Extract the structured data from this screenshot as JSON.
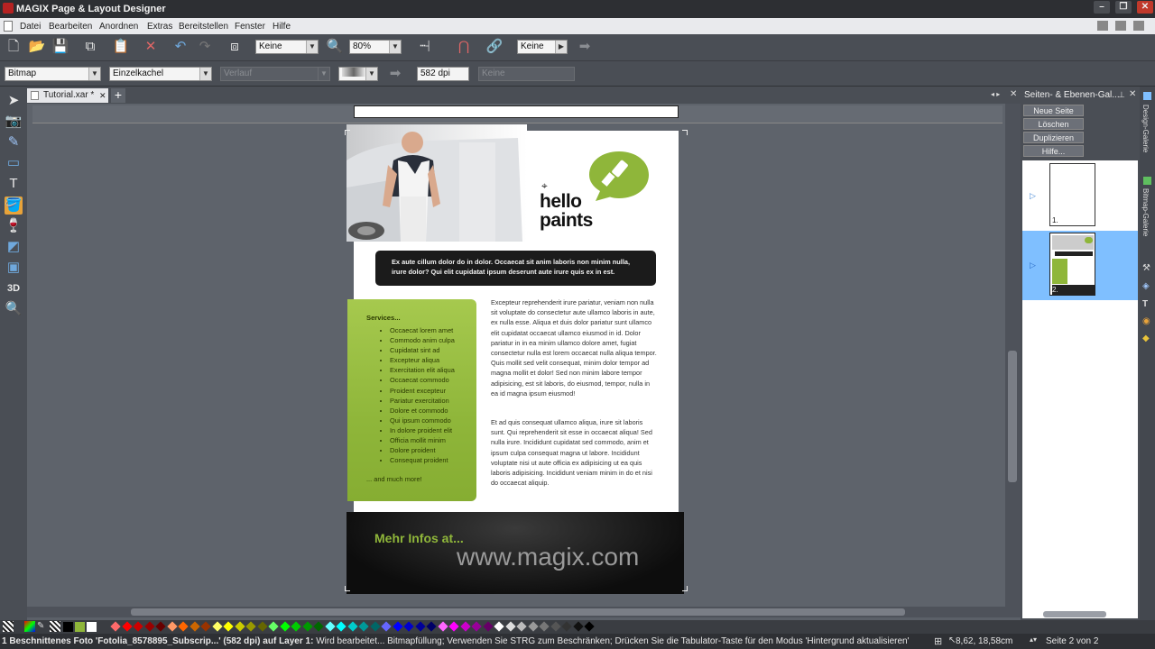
{
  "window": {
    "title": "MAGIX Page & Layout Designer"
  },
  "menu": [
    "Datei",
    "Bearbeiten",
    "Anordnen",
    "Extras",
    "Bereitstellen",
    "Fenster",
    "Hilfe"
  ],
  "toolbar1": {
    "blend_mode": "Keine",
    "zoom": "80%",
    "quality": "Keine"
  },
  "toolbar2": {
    "fill_type": "Bitmap",
    "tile_mode": "Einzelkachel",
    "gradient": "Verlauf",
    "dpi": "582 dpi",
    "effect": "Keine"
  },
  "document": {
    "tab": "Tutorial.xar *",
    "add_tab": "+"
  },
  "page": {
    "brand_line1": "hello",
    "brand_line2": "paints",
    "intro": "Ex aute cillum dolor do in dolor. Occaecat sit anim laboris non minim nulla, irure dolor? Qui elit cupidatat ipsum deserunt aute irure quis ex in est.",
    "services_heading": "Services...",
    "services": [
      "Occaecat lorem amet",
      "Commodo anim culpa",
      "Cupidatat sint ad",
      "Excepteur aliqua",
      "Exercitation elit aliqua",
      "Occaecat commodo",
      "Proident excepteur",
      "Pariatur exercitation",
      "Dolore et commodo",
      "Qui ipsum commodo",
      "In dolore proident elit",
      "Officia mollit minim",
      "Dolore proident",
      "Consequat proident"
    ],
    "services_more": "... and much more!",
    "para1": "Excepteur reprehenderit irure pariatur, veniam non nulla sit voluptate do consectetur aute ullamco laboris in aute, ex nulla esse. Aliqua et duis dolor pariatur sunt ullamco elit cupidatat occaecat ullamco eiusmod in id. Dolor pariatur in in ea minim ullamco dolore amet, fugiat consectetur nulla est lorem occaecat nulla aliqua tempor. Quis mollit sed velit consequat, minim dolor tempor ad magna mollit et dolor! Sed non minim labore tempor adipisicing, est sit laboris, do eiusmod, tempor, nulla in ea id magna ipsum eiusmod!",
    "para2": "Et ad quis consequat ullamco aliqua, irure sit laboris sunt. Qui reprehenderit sit esse in occaecat aliqua! Sed nulla irure. Incididunt cupidatat sed commodo, anim et ipsum culpa consequat magna ut labore. Incididunt voluptate nisi ut aute officia ex adipisicing ut ea quis laboris adipisicing. Incididunt veniam minim in do et nisi do occaecat aliquip.",
    "footer_heading": "Mehr Infos at...",
    "footer_url": "www.magix.com"
  },
  "gallery": {
    "title": "Seiten- & Ebenen-Gal...",
    "buttons": [
      "Neue Seite",
      "Löschen",
      "Duplizieren",
      "Hilfe..."
    ],
    "page1_label": "1.",
    "page2_label": "2."
  },
  "side_tabs": {
    "design": "Design-Galerie",
    "bitmap": "Bitmap-Galerie"
  },
  "status": {
    "message_bold": "1 Beschnittenes Foto 'Fotolia_8578895_Subscrip...' (582 dpi) auf Layer 1:",
    "message": " Wird bearbeitet... Bitmapfüllung; Verwenden Sie STRG zum Beschränken; Drücken Sie die Tabulator-Taste für den Modus 'Hintergrund aktualisieren'",
    "coords": "8,62, 18,58cm",
    "page": "Seite 2 von 2"
  },
  "colors": {
    "brand_green": "#8fb63a",
    "dark": "#1b1b1b",
    "selected_page": "#7fbfff",
    "palette": [
      "#ff6a6a",
      "#ff0000",
      "#cc0000",
      "#990000",
      "#660000",
      "#ff9966",
      "#ff6600",
      "#cc6600",
      "#993300",
      "#ffff66",
      "#ffff00",
      "#cccc00",
      "#999900",
      "#666600",
      "#66ff66",
      "#00ff00",
      "#00cc00",
      "#009900",
      "#006600",
      "#66ffff",
      "#00ffff",
      "#00cccc",
      "#009999",
      "#006666",
      "#6666ff",
      "#0000ff",
      "#0000cc",
      "#000099",
      "#000066",
      "#ff66ff",
      "#ff00ff",
      "#cc00cc",
      "#990099",
      "#660066",
      "#ffffff",
      "#dddddd",
      "#bbbbbb",
      "#999999",
      "#777777",
      "#555555",
      "#333333",
      "#111111",
      "#000000"
    ]
  }
}
